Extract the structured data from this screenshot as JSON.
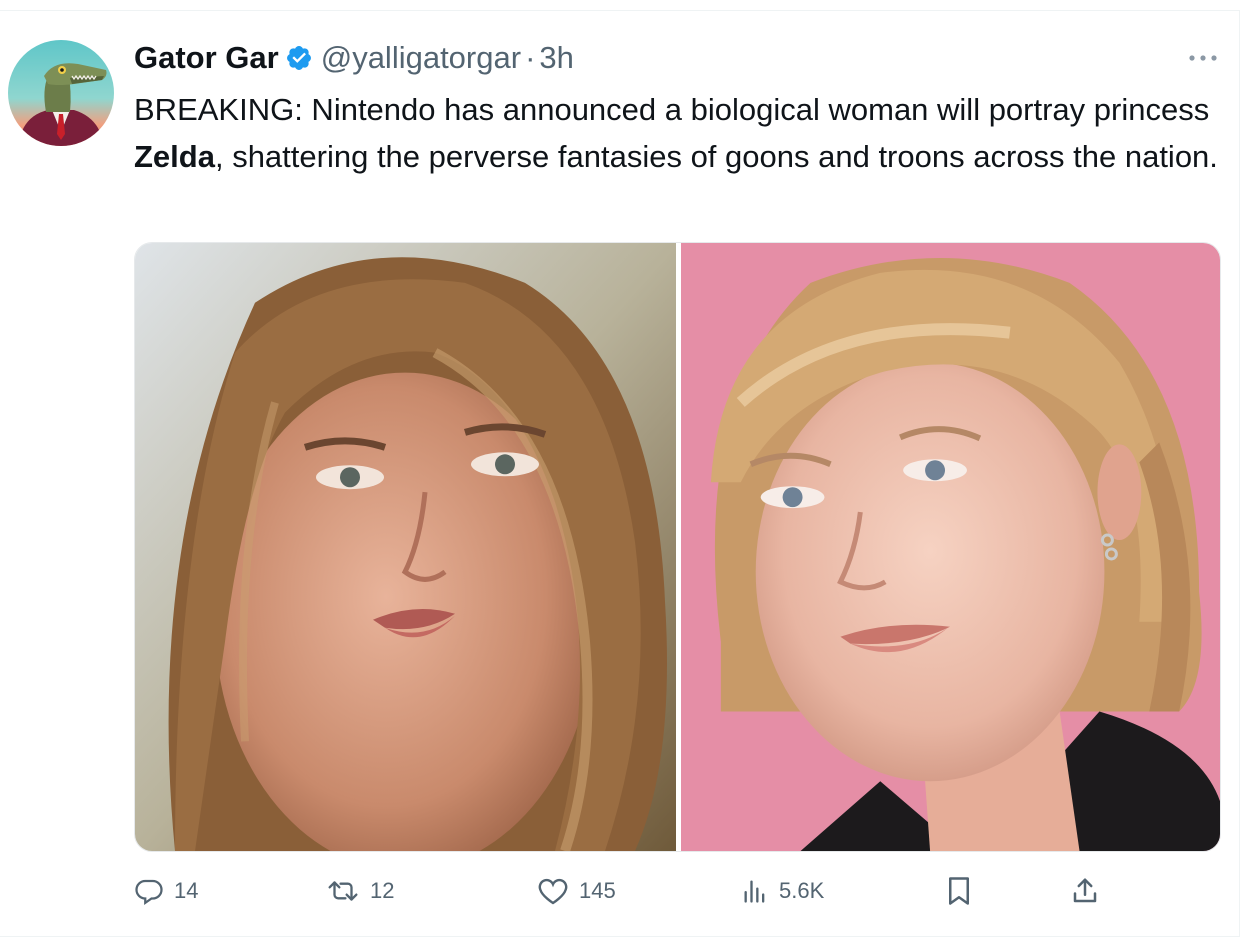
{
  "tweet": {
    "author": {
      "display_name": "Gator Gar",
      "verified": true,
      "handle": "@yalligatorgar",
      "separator": "·",
      "time": "3h",
      "avatar_icon": "alligator-in-suit-avatar"
    },
    "text": {
      "line_part1": "BREAKING: Nintendo has announced a biological woman will portray princess ",
      "bold_word": "Zelda",
      "line_part2": ", shattering the perverse fantasies of goons and troons across the nation."
    },
    "media": [
      {
        "name": "photo-left",
        "description_icon": "portrait-photo"
      },
      {
        "name": "photo-right",
        "description_icon": "portrait-photo"
      }
    ],
    "actions": {
      "replies": "14",
      "reposts": "12",
      "likes": "145",
      "views": "5.6K"
    }
  },
  "colors": {
    "text": "#0f1419",
    "secondary": "#536471",
    "verified": "#1d9bf0",
    "divider": "#eff3f4"
  }
}
